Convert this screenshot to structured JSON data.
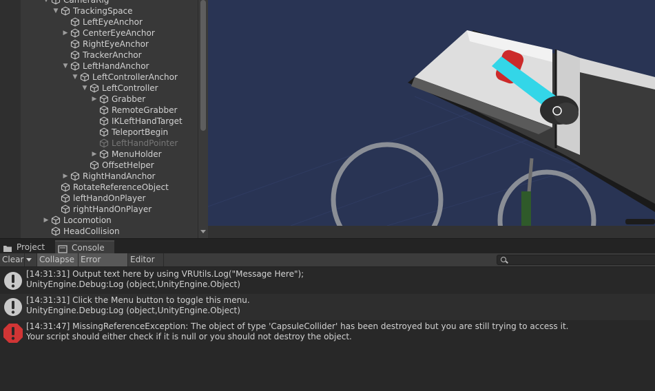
{
  "hierarchy": {
    "items": [
      {
        "label": "CameraRig",
        "depth": 4,
        "expander": "down",
        "dim": false
      },
      {
        "label": "TrackingSpace",
        "depth": 5,
        "expander": "down",
        "dim": false
      },
      {
        "label": "LeftEyeAnchor",
        "depth": 6,
        "expander": "none",
        "dim": false
      },
      {
        "label": "CenterEyeAnchor",
        "depth": 6,
        "expander": "right",
        "dim": false
      },
      {
        "label": "RightEyeAnchor",
        "depth": 6,
        "expander": "none",
        "dim": false
      },
      {
        "label": "TrackerAnchor",
        "depth": 6,
        "expander": "none",
        "dim": false
      },
      {
        "label": "LeftHandAnchor",
        "depth": 6,
        "expander": "down",
        "dim": false
      },
      {
        "label": "LeftControllerAnchor",
        "depth": 7,
        "expander": "down",
        "dim": false
      },
      {
        "label": "LeftController",
        "depth": 8,
        "expander": "down",
        "dim": false
      },
      {
        "label": "Grabber",
        "depth": 9,
        "expander": "right",
        "dim": false
      },
      {
        "label": "RemoteGrabber",
        "depth": 9,
        "expander": "none",
        "dim": false
      },
      {
        "label": "IKLeftHandTarget",
        "depth": 9,
        "expander": "none",
        "dim": false
      },
      {
        "label": "TeleportBegin",
        "depth": 9,
        "expander": "none",
        "dim": false
      },
      {
        "label": "LeftHandPointer",
        "depth": 9,
        "expander": "none",
        "dim": true
      },
      {
        "label": "MenuHolder",
        "depth": 9,
        "expander": "right",
        "dim": false
      },
      {
        "label": "OffsetHelper",
        "depth": 8,
        "expander": "none",
        "dim": false
      },
      {
        "label": "RightHandAnchor",
        "depth": 6,
        "expander": "right",
        "dim": false
      },
      {
        "label": "RotateReferenceObject",
        "depth": 5,
        "expander": "none",
        "dim": false
      },
      {
        "label": "leftHandOnPlayer",
        "depth": 5,
        "expander": "none",
        "dim": false
      },
      {
        "label": "rightHandOnPlayer",
        "depth": 5,
        "expander": "none",
        "dim": false
      },
      {
        "label": "Locomotion",
        "depth": 4,
        "expander": "right",
        "dim": false
      },
      {
        "label": "HeadCollision",
        "depth": 4,
        "expander": "none",
        "dim": false
      }
    ]
  },
  "tabs": [
    {
      "label": "Project",
      "icon": "folder-icon",
      "active": false
    },
    {
      "label": "Console",
      "icon": "console-icon",
      "active": true
    }
  ],
  "toolbar": {
    "clear": "Clear",
    "collapse": "Collapse",
    "error_pause": "Error Pause",
    "editor": "Editor",
    "search_value": ""
  },
  "console": {
    "entries": [
      {
        "type": "info",
        "line1": "[14:31:31] Output text here by using VRUtils.Log(\"Message Here\");",
        "line2": "UnityEngine.Debug:Log (object,UnityEngine.Object)"
      },
      {
        "type": "info",
        "line1": "[14:31:31] Click the Menu button to toggle this menu.",
        "line2": "UnityEngine.Debug:Log (object,UnityEngine.Object)"
      },
      {
        "type": "error",
        "line1": "[14:31:47] MissingReferenceException: The object of type 'CapsuleCollider' has been destroyed but you are still trying to access it.",
        "line2": "Your script should either check if it is null or you should not destroy the object."
      }
    ]
  },
  "colors": {
    "scene_background": "#293454",
    "info_icon": "#c9c9c9",
    "error_icon": "#d03535",
    "pointer_cyan": "#33d6e8"
  }
}
